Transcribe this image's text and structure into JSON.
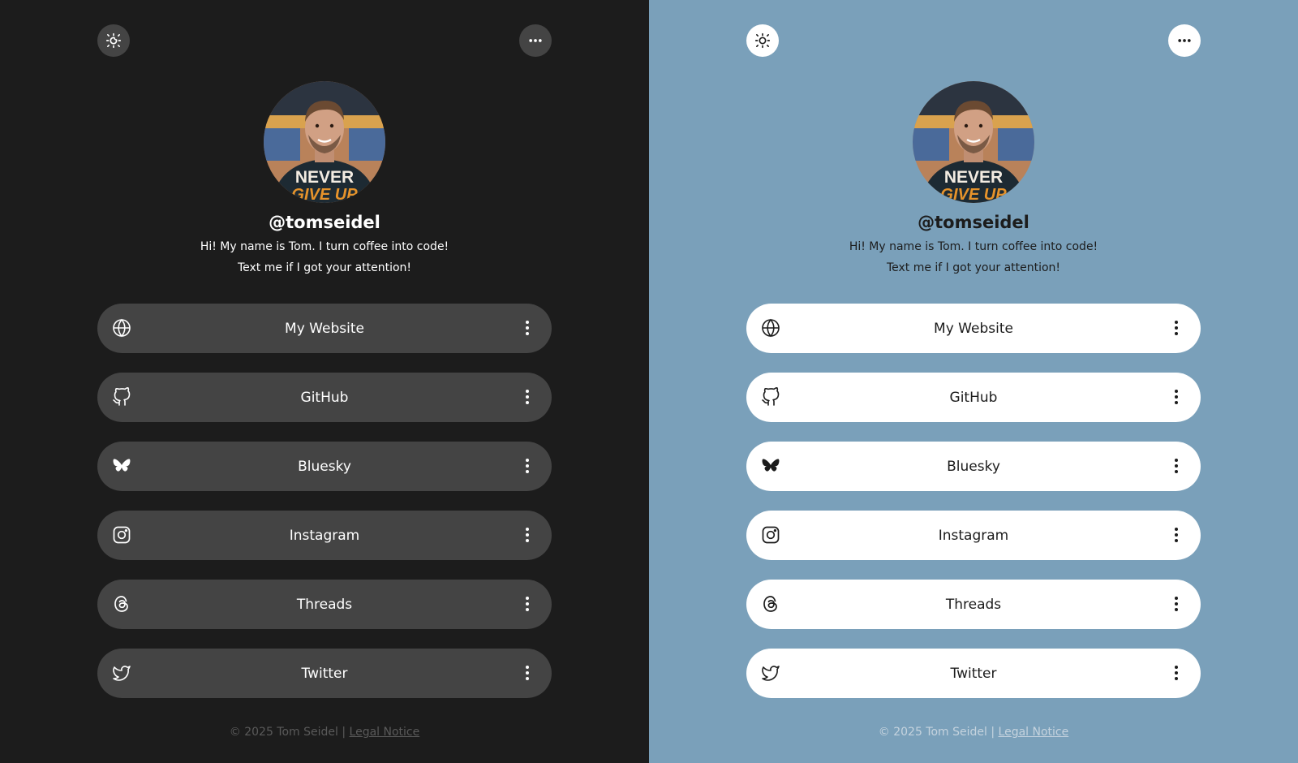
{
  "colors": {
    "dark_background": "#1c1c1c",
    "dark_button": "#444444",
    "light_background": "#7aa0ba",
    "light_button": "#ffffff",
    "text_dark": "#1c1c1c",
    "text_light": "#ffffff"
  },
  "panels": [
    {
      "theme": "dark",
      "theme_toggle_icon": "moon-sun-icon",
      "more_icon": "more-horizontal-icon",
      "profile": {
        "handle": "@tomseidel",
        "bio_line_1": "Hi! My name is Tom. I turn coffee into code!",
        "bio_line_2": "Text me if I got your attention!",
        "avatar_shirt_text_1": "NEVER",
        "avatar_shirt_text_2": "GIVE UP"
      },
      "links": [
        {
          "label": "My Website",
          "icon": "globe-icon"
        },
        {
          "label": "GitHub",
          "icon": "github-icon"
        },
        {
          "label": "Bluesky",
          "icon": "bluesky-icon"
        },
        {
          "label": "Instagram",
          "icon": "instagram-icon"
        },
        {
          "label": "Threads",
          "icon": "threads-icon"
        },
        {
          "label": "Twitter",
          "icon": "twitter-icon"
        }
      ],
      "footer": {
        "copyright": "© 2025 Tom Seidel |",
        "legal_link": "Legal Notice"
      }
    },
    {
      "theme": "light",
      "theme_toggle_icon": "sun-icon",
      "more_icon": "more-horizontal-icon",
      "profile": {
        "handle": "@tomseidel",
        "bio_line_1": "Hi! My name is Tom. I turn coffee into code!",
        "bio_line_2": "Text me if I got your attention!",
        "avatar_shirt_text_1": "NEVER",
        "avatar_shirt_text_2": "GIVE UP"
      },
      "links": [
        {
          "label": "My Website",
          "icon": "globe-icon"
        },
        {
          "label": "GitHub",
          "icon": "github-icon"
        },
        {
          "label": "Bluesky",
          "icon": "bluesky-icon"
        },
        {
          "label": "Instagram",
          "icon": "instagram-icon"
        },
        {
          "label": "Threads",
          "icon": "threads-icon"
        },
        {
          "label": "Twitter",
          "icon": "twitter-icon"
        }
      ],
      "footer": {
        "copyright": "© 2025 Tom Seidel |",
        "legal_link": "Legal Notice"
      }
    }
  ]
}
